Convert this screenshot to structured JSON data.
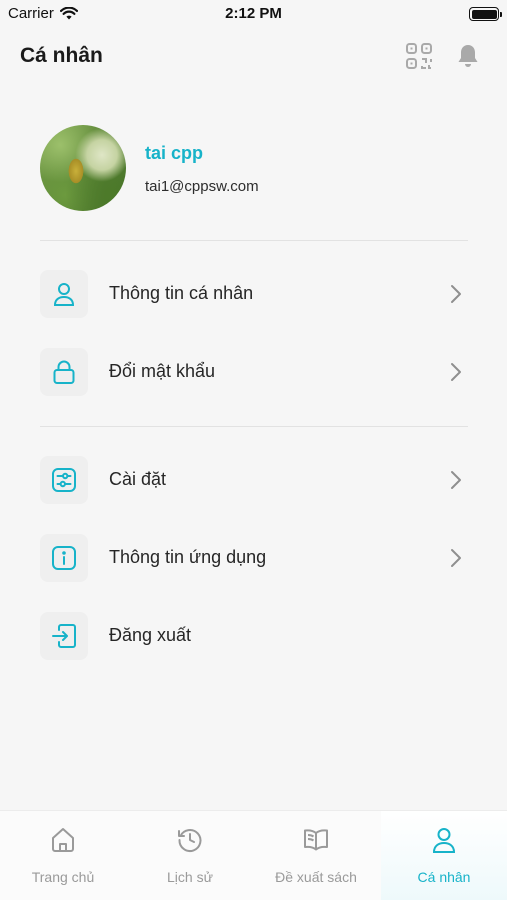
{
  "status_bar": {
    "carrier": "Carrier",
    "time": "2:12 PM"
  },
  "header": {
    "title": "Cá nhân"
  },
  "profile": {
    "name": "tai cpp",
    "email": "tai1@cppsw.com"
  },
  "menu": [
    {
      "label": "Thông tin cá nhân",
      "icon": "user-icon"
    },
    {
      "label": "Đổi mật khẩu",
      "icon": "lock-icon"
    },
    {
      "label": "Cài đặt",
      "icon": "settings-sliders-icon"
    },
    {
      "label": "Thông tin ứng dụng",
      "icon": "info-icon"
    },
    {
      "label": "Đăng xuất",
      "icon": "logout-icon"
    }
  ],
  "tabs": [
    {
      "label": "Trang chủ",
      "icon": "home-icon"
    },
    {
      "label": "Lịch sử",
      "icon": "history-icon"
    },
    {
      "label": "Đề xuất sách",
      "icon": "book-icon"
    },
    {
      "label": "Cá nhân",
      "icon": "user-icon",
      "active": true
    }
  ],
  "colors": {
    "accent": "#17b3c9",
    "inactive_tab": "#9a9a9a",
    "background": "#f6f6f6"
  }
}
